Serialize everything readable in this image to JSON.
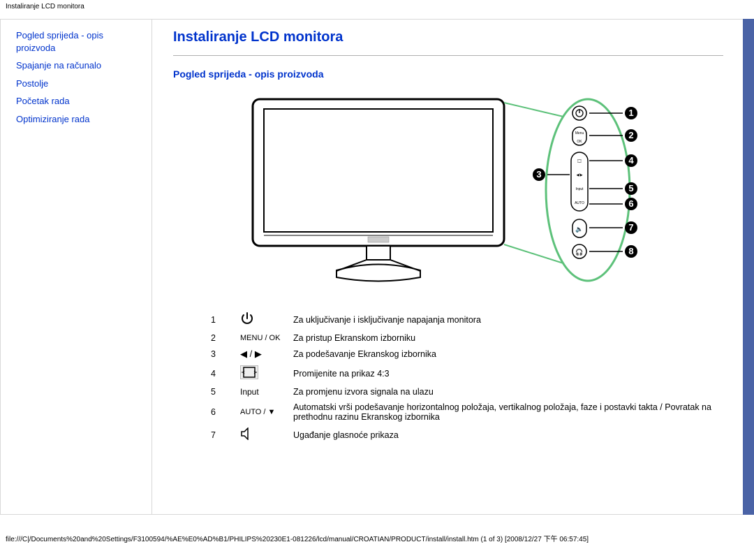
{
  "header": {
    "label": "Instaliranje LCD monitora"
  },
  "sidebar": {
    "items": [
      {
        "label": "Pogled sprijeda - opis proizvoda"
      },
      {
        "label": "Spajanje na računalo"
      },
      {
        "label": "Postolje"
      },
      {
        "label": "Početak rada"
      },
      {
        "label": "Optimiziranje rada"
      }
    ]
  },
  "main": {
    "title": "Instaliranje LCD monitora",
    "subtitle": "Pogled sprijeda - opis proizvoda",
    "legend": [
      {
        "num": "1",
        "icon": "power",
        "desc": "Za uključivanje i isključivanje napajanja monitora"
      },
      {
        "num": "2",
        "icon": "menuok",
        "icon_text": "MENU / OK",
        "desc": "Za pristup Ekranskom izborniku"
      },
      {
        "num": "3",
        "icon": "leftright",
        "desc": "Za podešavanje Ekranskog izbornika"
      },
      {
        "num": "4",
        "icon": "aspect",
        "desc": "Promijenite na prikaz 4:3"
      },
      {
        "num": "5",
        "icon": "input",
        "icon_text": "Input",
        "desc": "Za promjenu izvora signala na ulazu"
      },
      {
        "num": "6",
        "icon": "autodown",
        "icon_text": "AUTO / ▼",
        "desc": "Automatski vrši podešavanje horizontalnog položaja, vertikalnog položaja, faze i postavki takta / Povratak na prethodnu razinu Ekranskog izbornika"
      },
      {
        "num": "7",
        "icon": "speaker",
        "desc": "Ugađanje glasnoće prikaza"
      }
    ],
    "callouts": [
      "1",
      "2",
      "3",
      "4",
      "5",
      "6",
      "7",
      "8"
    ],
    "panel_labels": {
      "menu": "Menu",
      "ok": "OK",
      "aspect": "4:3",
      "updown": "▲/▼",
      "lr": "◀/▶",
      "input": "Input",
      "auto": "AUTO"
    }
  },
  "footer": {
    "path": "file:///C|/Documents%20and%20Settings/F3100594/%AE%E0%AD%B1/PHILIPS%20230E1-081226/lcd/manual/CROATIAN/PRODUCT/install/install.htm (1 of 3) [2008/12/27 下午 06:57:45]"
  }
}
